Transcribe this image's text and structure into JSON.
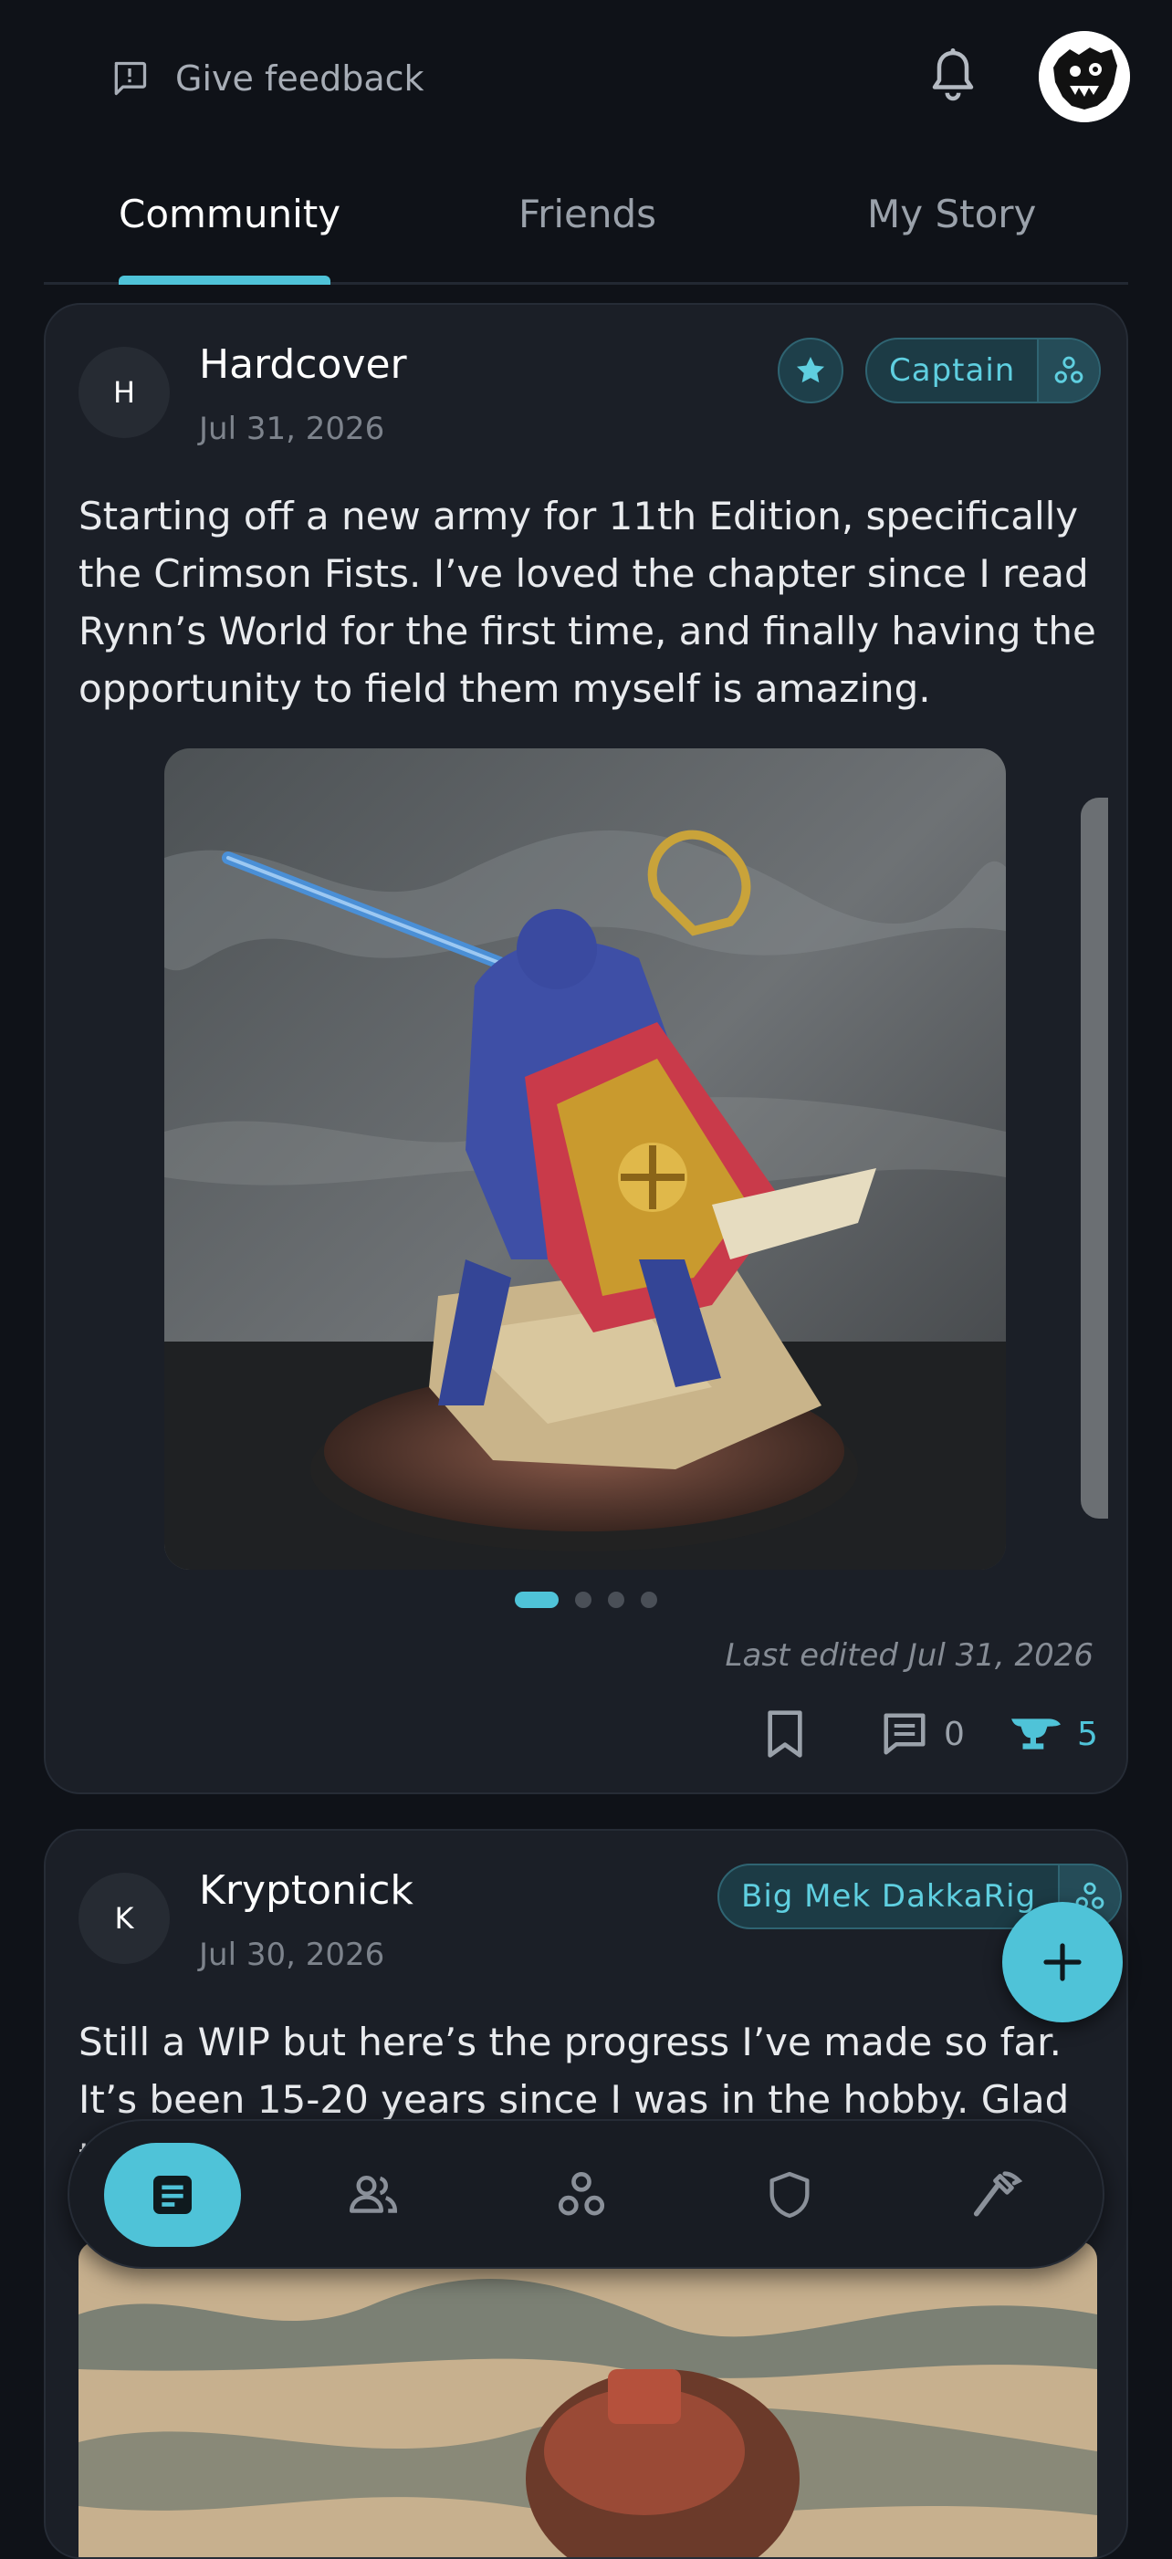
{
  "header": {
    "feedback_label": "Give feedback"
  },
  "tabs": [
    {
      "label": "Community",
      "active": true
    },
    {
      "label": "Friends",
      "active": false
    },
    {
      "label": "My Story",
      "active": false
    }
  ],
  "posts": [
    {
      "author_initial": "H",
      "author": "Hardcover",
      "date": "Jul 31, 2026",
      "starred": true,
      "rank": "Captain",
      "body": "Starting off a new army for 11th Edition, specifically the Crimson Fists. I’ve loved the chapter since I read Rynn’s World for the first time, and finally having the opportunity to field them myself is amazing.",
      "image_count": 4,
      "active_image": 1,
      "last_edited": "Last edited Jul 31, 2026",
      "comments": "0",
      "anvils": "5"
    },
    {
      "author_initial": "K",
      "author": "Kryptonick",
      "date": "Jul 30, 2026",
      "rank": "Big Mek DakkaRig",
      "body": "Still a WIP but here’s the progress I’ve made so far. It’s been 15-20 years since I was in the hobby. Glad to be"
    }
  ],
  "bottom_nav": [
    {
      "icon": "feed-icon",
      "active": true
    },
    {
      "icon": "people-icon",
      "active": false
    },
    {
      "icon": "circles-icon",
      "active": false
    },
    {
      "icon": "shield-icon",
      "active": false
    },
    {
      "icon": "hammer-icon",
      "active": false
    }
  ],
  "colors": {
    "background": "#0f1218",
    "card": "#1b1f27",
    "accent": "#4fc3d8"
  }
}
